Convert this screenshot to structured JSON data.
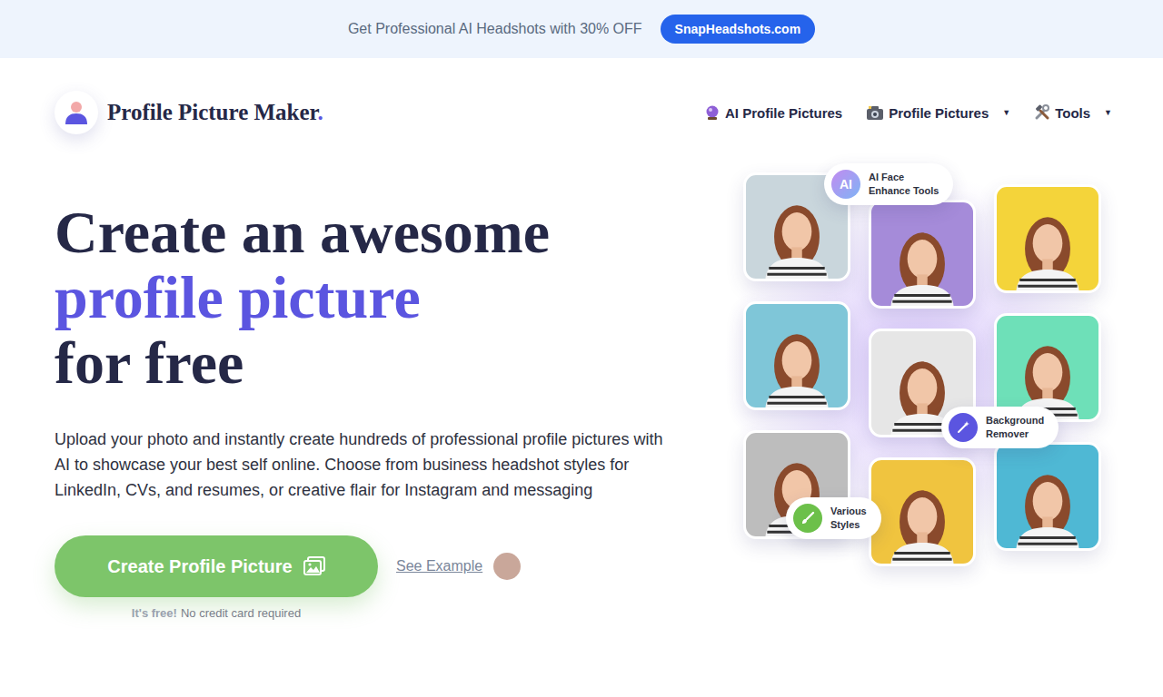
{
  "banner": {
    "text": "Get Professional AI Headshots with 30% OFF",
    "button": "SnapHeadshots.com"
  },
  "logo": {
    "name": "Profile Picture Maker",
    "dot": "."
  },
  "nav": [
    {
      "label": "AI Profile Pictures"
    },
    {
      "label": "Profile Pictures",
      "caret": "▼"
    },
    {
      "label": "Tools",
      "caret": "▼"
    }
  ],
  "hero": {
    "title": [
      {
        "text": "Create an awesome",
        "highlight": false
      },
      {
        "text": "profile picture",
        "highlight": true
      },
      {
        "text": "for free",
        "highlight": false
      }
    ],
    "description": "Upload your photo and instantly create hundreds of professional profile pictures with AI to showcase your best self online. Choose from business headshot styles for LinkedIn, CVs, and resumes, or creative flair for Instagram and messaging",
    "cta": "Create Profile Picture",
    "example": {
      "label": "See Example",
      "avatar_color": "#c9a79a"
    },
    "note": {
      "bold": "It's free!",
      "text": "No credit card required"
    }
  },
  "collage": {
    "columns": [
      [
        {
          "color": "#c9d6dc"
        },
        {
          "color": "#7fc6d8"
        },
        {
          "color": "#bdbdbd"
        }
      ],
      [
        {
          "color": "#a58bd9"
        },
        {
          "color": "#e6e6e6"
        },
        {
          "color": "#f0c43f"
        }
      ],
      [
        {
          "color": "#f4d43a"
        },
        {
          "color": "#6ee0b8"
        },
        {
          "color": "#4fb8d4"
        }
      ]
    ],
    "badges": [
      {
        "icon": "AI",
        "lines": [
          "AI Face",
          "Enhance Tools"
        ]
      },
      {
        "lines": [
          "Background",
          "Remover"
        ]
      },
      {
        "lines": [
          "Various",
          "Styles"
        ]
      }
    ]
  }
}
